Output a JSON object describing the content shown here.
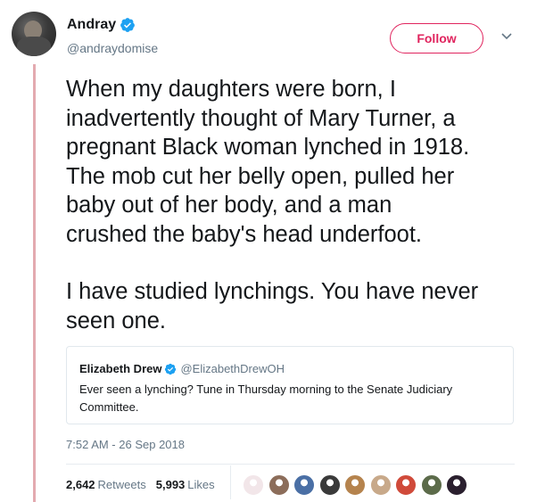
{
  "author": {
    "display_name": "Andray",
    "handle": "@andraydomise",
    "verified": true,
    "avatar_icon": "user-avatar"
  },
  "follow_button": {
    "label": "Follow",
    "color": "#e0245e"
  },
  "menu": {
    "icon": "chevron-down-icon"
  },
  "tweet": {
    "paragraph1": [
      "When my daughters were born, I",
      "inadvertently thought of Mary Turner, a",
      "pregnant Black woman lynched in 1918.",
      "The mob cut her belly open, pulled her",
      "baby out of her body, and a man",
      "crushed the baby's head underfoot."
    ],
    "paragraph2": [
      "I have studied lynchings. You have never",
      "seen one."
    ]
  },
  "quoted_tweet": {
    "display_name": "Elizabeth Drew",
    "handle": "@ElizabethDrewOH",
    "verified": true,
    "text": "Ever seen a lynching? Tune in Thursday morning to the Senate Judiciary Committee."
  },
  "timestamp": "7:52 AM - 26 Sep 2018",
  "stats": {
    "retweets_count": "2,642",
    "retweets_label": "Retweets",
    "likes_count": "5,993",
    "likes_label": "Likes"
  },
  "likers": [
    {
      "icon": "liker-avatar-1",
      "color": "#f2e6e9"
    },
    {
      "icon": "liker-avatar-2",
      "color": "#8c6d5a"
    },
    {
      "icon": "liker-avatar-3",
      "color": "#4a6fa5"
    },
    {
      "icon": "liker-avatar-4",
      "color": "#3a3a3a"
    },
    {
      "icon": "liker-avatar-5",
      "color": "#b5834d"
    },
    {
      "icon": "liker-avatar-6",
      "color": "#c8a98a"
    },
    {
      "icon": "liker-avatar-7",
      "color": "#d04a3a"
    },
    {
      "icon": "liker-avatar-8",
      "color": "#5c6b4a"
    },
    {
      "icon": "liker-avatar-9",
      "color": "#2a1f2e"
    }
  ],
  "colors": {
    "thread_line": "#e3aab0",
    "verified_blue": "#1da1f2",
    "secondary_text": "#657786"
  }
}
